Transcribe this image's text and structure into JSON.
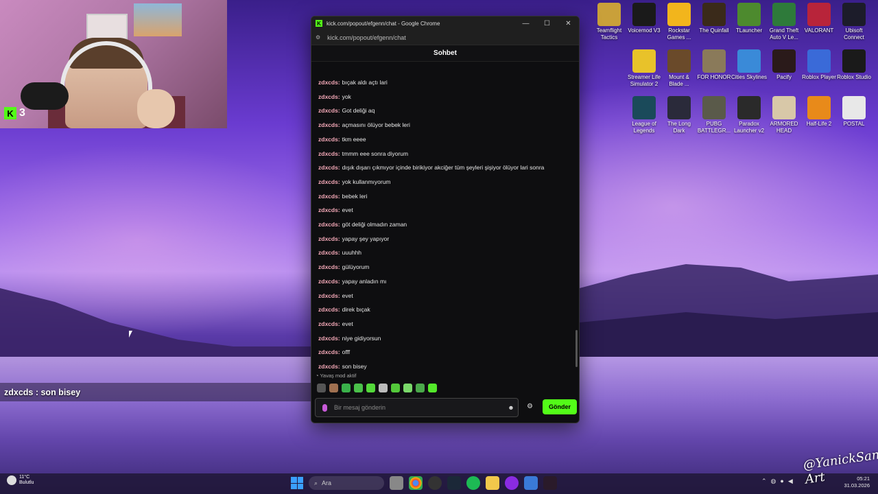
{
  "webcam": {
    "kick_count": "3"
  },
  "desktop_icons": [
    {
      "label": "Teamflight Tactics",
      "icon": "teamfight-tactics-icon",
      "color": "#c9a03a"
    },
    {
      "label": "Voicemod V3",
      "icon": "voicemod-icon",
      "color": "#1a1a1a"
    },
    {
      "label": "Rockstar Games ...",
      "icon": "rockstar-icon",
      "color": "#f2b51c"
    },
    {
      "label": "The Quinfall",
      "icon": "quinfall-icon",
      "color": "#3a2a1a"
    },
    {
      "label": "TLauncher",
      "icon": "tlauncher-icon",
      "color": "#4d8a2e"
    },
    {
      "label": "Grand Theft Auto V Le...",
      "icon": "gta-icon",
      "color": "#2e7a3a"
    },
    {
      "label": "VALORANT",
      "icon": "valorant-icon",
      "color": "#b8243a"
    },
    {
      "label": "Ubisoft Connect",
      "icon": "ubisoft-icon",
      "color": "#1c1c2a"
    },
    {
      "label": "Streamer Life Simulator 2",
      "icon": "streamer-life-icon",
      "color": "#e8c22a"
    },
    {
      "label": "Mount & Blade ...",
      "icon": "mount-blade-icon",
      "color": "#6a4a2a"
    },
    {
      "label": "FOR HONOR",
      "icon": "for-honor-icon",
      "color": "#8a7a5a"
    },
    {
      "label": "Cities Skylines",
      "icon": "cities-skylines-icon",
      "color": "#3a8ad8"
    },
    {
      "label": "Pacify",
      "icon": "pacify-icon",
      "color": "#2a1a1a"
    },
    {
      "label": "Roblox Player",
      "icon": "roblox-icon",
      "color": "#3a6ad8"
    },
    {
      "label": "Roblox Studio",
      "icon": "roblox-studio-icon",
      "color": "#1a1a1a"
    },
    {
      "label": "League of Legends",
      "icon": "league-icon",
      "color": "#1a4a5a"
    },
    {
      "label": "The Long Dark",
      "icon": "long-dark-icon",
      "color": "#2a2a3a"
    },
    {
      "label": "PUBG BATTLEGR...",
      "icon": "pubg-icon",
      "color": "#5a5a4a"
    },
    {
      "label": "Paradox Launcher v2",
      "icon": "paradox-icon",
      "color": "#2a2a2a"
    },
    {
      "label": "ARMORED HEAD",
      "icon": "armored-head-icon",
      "color": "#d8c8a8"
    },
    {
      "label": "Half-Life 2",
      "icon": "half-life-icon",
      "color": "#e88a1a"
    },
    {
      "label": "POSTAL",
      "icon": "postal-icon",
      "color": "#e8e8e8"
    }
  ],
  "window": {
    "title": "kick.com/popout/efgenn/chat - Google Chrome",
    "url": "kick.com/popout/efgenn/chat",
    "chat_header": "Sohbet"
  },
  "chat": {
    "messages": [
      {
        "user": "zdxcds:",
        "text": "bıçak aldı açtı lari"
      },
      {
        "user": "zdxcds:",
        "text": "yok"
      },
      {
        "user": "zdxcds:",
        "text": "Got deliği aq"
      },
      {
        "user": "zdxcds:",
        "text": "açmasını ölüyor bebek leri"
      },
      {
        "user": "zdxcds:",
        "text": "tkm eeee"
      },
      {
        "user": "zdxcds:",
        "text": "tmmm eee sonra diyorum"
      },
      {
        "user": "zdxcds:",
        "text": "dışık dışarı çıkmıyor içinde birikiyor akciğer tüm şeyleri şişiyor ölüyor lari sonra"
      },
      {
        "user": "zdxcds:",
        "text": "yok kullanmıyorum"
      },
      {
        "user": "zdxcds:",
        "text": "bebek leri"
      },
      {
        "user": "zdxcds:",
        "text": "evet"
      },
      {
        "user": "zdxcds:",
        "text": "göt deliği olmadın zaman"
      },
      {
        "user": "zdxcds:",
        "text": "yapay şey yapıyor"
      },
      {
        "user": "zdxcds:",
        "text": "uuuhhh"
      },
      {
        "user": "zdxcds:",
        "text": "gülüyorum"
      },
      {
        "user": "zdxcds:",
        "text": "yapay anladın mı"
      },
      {
        "user": "zdxcds:",
        "text": "evet"
      },
      {
        "user": "zdxcds:",
        "text": "direk bıçak"
      },
      {
        "user": "zdxcds:",
        "text": "evet"
      },
      {
        "user": "zdxcds:",
        "text": "niye gidiyorsun"
      },
      {
        "user": "zdxcds:",
        "text": "offf"
      },
      {
        "user": "zdxcds:",
        "text": "son bisey"
      }
    ],
    "slow_mode": "Yavaş mod aktif",
    "input_placeholder": "Bir mesaj gönderin",
    "send_label": "Gönder",
    "accent": "#53fc18",
    "username_color": "#f5a9b8"
  },
  "overlay_line": "zdxcds : son bisey",
  "taskbar": {
    "weather_temp": "11°C",
    "weather_desc": "Bulutlu",
    "search_placeholder": "Ara",
    "time": "05:21",
    "date": "31.03.2026"
  },
  "signature": "@YanickSan Art"
}
